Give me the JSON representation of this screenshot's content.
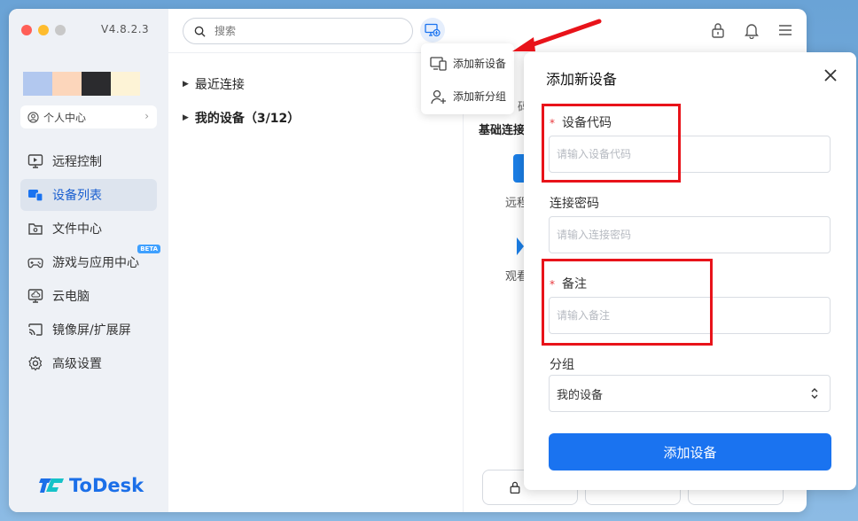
{
  "app": {
    "version": "V4.8.2.3",
    "brand": "ToDesk"
  },
  "colors": {
    "accent": "#1a73f0",
    "required": "#e8383d",
    "highlight": "#e8131a"
  },
  "sidebar": {
    "profile_label": "个人中心",
    "items": [
      {
        "label": "远程控制",
        "icon": "monitor-remote-icon"
      },
      {
        "label": "设备列表",
        "icon": "device-list-icon",
        "active": true
      },
      {
        "label": "文件中心",
        "icon": "folder-icon"
      },
      {
        "label": "游戏与应用中心",
        "icon": "gamepad-icon",
        "badge": "BETA"
      },
      {
        "label": "云电脑",
        "icon": "cloud-pc-icon"
      },
      {
        "label": "镜像屏/扩展屏",
        "icon": "cast-icon"
      },
      {
        "label": "高级设置",
        "icon": "gear-icon"
      }
    ]
  },
  "topbar": {
    "search_placeholder": "搜索"
  },
  "device_tree": {
    "recent": "最近连接",
    "mine": "我的设备（3/12）"
  },
  "right_panel": {
    "basic_title": "基础连接",
    "peek_ma": "码",
    "peek_remote": "远程",
    "peek_watch": "观看"
  },
  "dropdown": {
    "items": [
      {
        "label": "添加新设备",
        "icon": "add-device-icon"
      },
      {
        "label": "添加新分组",
        "icon": "add-group-icon"
      }
    ]
  },
  "dialog": {
    "title": "添加新设备",
    "required_mark": "*",
    "device_code": {
      "label": "设备代码",
      "placeholder": "请输入设备代码"
    },
    "password": {
      "label": "连接密码",
      "placeholder": "请输入连接密码"
    },
    "remark": {
      "label": "备注",
      "placeholder": "请输入备注"
    },
    "group": {
      "label": "分组",
      "selected": "我的设备"
    },
    "submit": "添加设备"
  }
}
